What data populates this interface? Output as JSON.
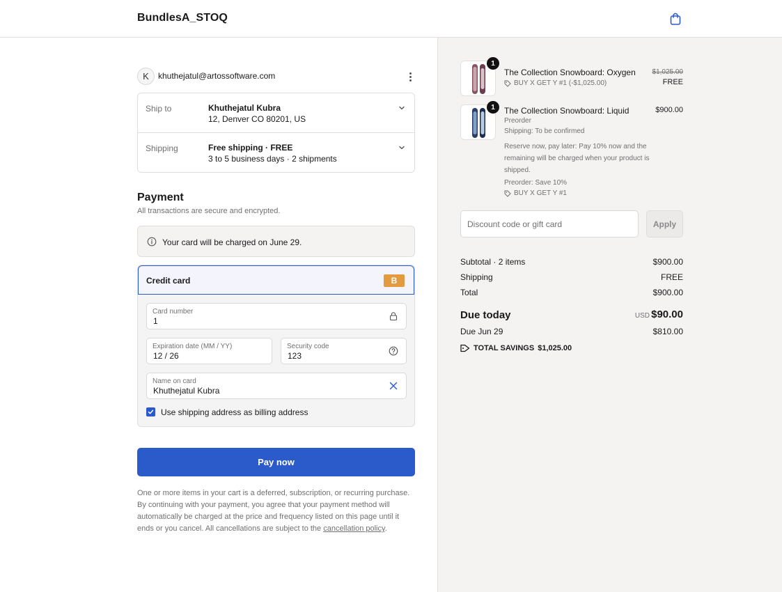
{
  "header": {
    "store_name": "BundlesA_STOQ",
    "cart_icon": "shopping-bag-icon"
  },
  "contact": {
    "avatar_initial": "K",
    "email": "khuthejatul@artossoftware.com"
  },
  "review": {
    "ship_to": {
      "label": "Ship to",
      "name": "Khuthejatul Kubra",
      "address": "12, Denver CO 80201, US"
    },
    "shipping": {
      "label": "Shipping",
      "method": "Free shipping · FREE",
      "details": "3 to 5 business days · 2 shipments"
    }
  },
  "payment": {
    "heading": "Payment",
    "subheading": "All transactions are secure and encrypted.",
    "notice": "Your card will be charged on June 29.",
    "method_label": "Credit card",
    "card_brand": "B",
    "card_brand_color": "#e39b3f",
    "fields": {
      "card_number": {
        "label": "Card number",
        "value": "1"
      },
      "expiration": {
        "label": "Expiration date (MM / YY)",
        "value": "12 / 26"
      },
      "security_code": {
        "label": "Security code",
        "value": "123"
      },
      "name_on_card": {
        "label": "Name on card",
        "value": "Khuthejatul Kubra"
      }
    },
    "billing_checkbox_label": "Use shipping address as billing address",
    "billing_checked": true,
    "pay_button": "Pay now",
    "accent_color": "#2b5acb",
    "legal_text": "One or more items in your cart is a deferred, subscription, or recurring purchase. By continuing with your payment, you agree that your payment method will automatically be charged at the price and frequency listed on this page until it ends or you cancel. All cancellations are subject to the",
    "legal_link": "cancellation policy",
    "legal_end": "."
  },
  "order": {
    "items": [
      {
        "name": "The Collection Snowboard: Oxygen",
        "quantity": "1",
        "discount": "BUY X GET Y #1 (-$1,025.00)",
        "original_price": "$1,025.00",
        "price": "FREE"
      },
      {
        "name": "The Collection Snowboard: Liquid",
        "quantity": "1",
        "price": "$900.00",
        "preorder": "Preorder",
        "shipping_note": "Shipping: To be confirmed",
        "description": "Reserve now, pay later: Pay 10% now and the remaining will be charged when your product is shipped.",
        "preorder_save": "Preorder: Save 10%",
        "discount": "BUY X GET Y #1"
      }
    ],
    "discount_placeholder": "Discount code or gift card",
    "apply_button": "Apply",
    "subtotal_label": "Subtotal · 2 items",
    "subtotal": "$900.00",
    "shipping_label": "Shipping",
    "shipping": "FREE",
    "total_label": "Total",
    "total": "$900.00",
    "due_today_label": "Due today",
    "currency": "USD",
    "due_today": "$90.00",
    "due_later_label": "Due Jun 29",
    "due_later": "$810.00",
    "savings_label": "TOTAL SAVINGS",
    "savings": "$1,025.00"
  }
}
